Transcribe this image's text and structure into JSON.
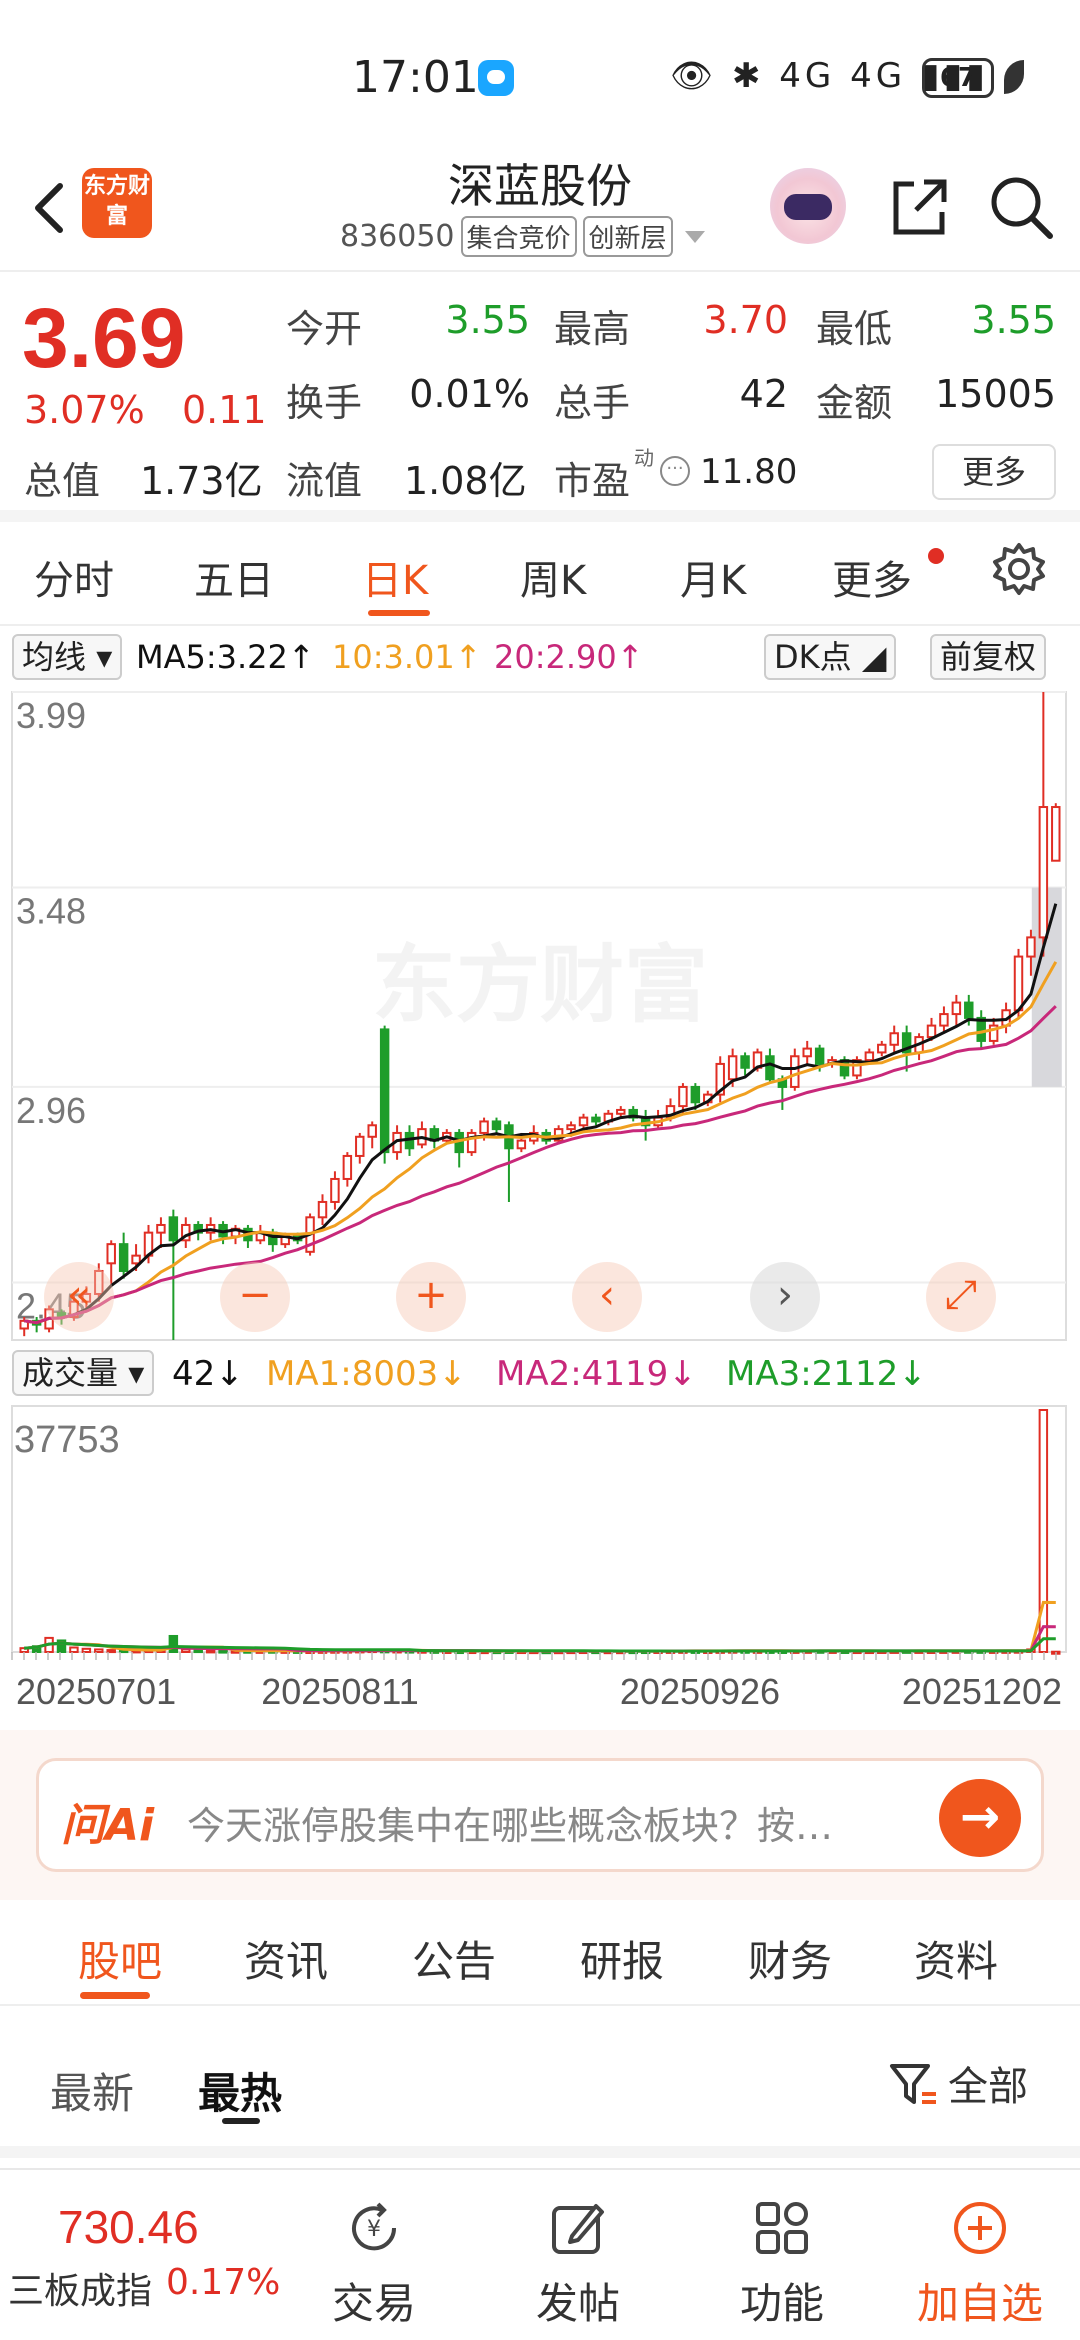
{
  "status_bar": {
    "time": "17:01",
    "battery": "67",
    "signal_text": "4G 4G"
  },
  "header": {
    "title": "深蓝股份",
    "code": "836050",
    "tags": [
      "集合竞价",
      "创新层"
    ],
    "logo_text": "东方财富"
  },
  "quote": {
    "price": "3.69",
    "change_pct": "3.07%",
    "change_amt": "0.11",
    "rows": [
      [
        {
          "l": "今开",
          "v": "3.55",
          "c": "green"
        },
        {
          "l": "最高",
          "v": "3.70",
          "c": "red"
        },
        {
          "l": "最低",
          "v": "3.55",
          "c": "green"
        }
      ],
      [
        {
          "l": "换手",
          "v": "0.01%",
          "c": ""
        },
        {
          "l": "总手",
          "v": "42",
          "c": ""
        },
        {
          "l": "金额",
          "v": "15005",
          "c": ""
        }
      ]
    ],
    "total_value_label": "总值",
    "total_value": "1.73亿",
    "float_value_label": "流值",
    "float_value": "1.08亿",
    "pe_label": "市盈",
    "pe_sup": "动",
    "pe_value": "11.80",
    "more": "更多"
  },
  "kline_tabs": [
    "分时",
    "五日",
    "日K",
    "周K",
    "月K",
    "更多"
  ],
  "kline_active": "日K",
  "ma_row": {
    "type_btn": "均线",
    "ma5": "MA5:3.22↑",
    "ma10": "10:3.01↑",
    "ma20": "20:2.90↑",
    "dk_btn": "DK点",
    "adjust_btn": "前复权"
  },
  "vol_row": {
    "type_btn": "成交量",
    "vol": "42↓",
    "ma1": "MA1:8003↓",
    "ma2": "MA2:4119↓",
    "ma3": "MA3:2112↓",
    "max_label": "37753"
  },
  "colors": {
    "up": "#e02e24",
    "down": "#1e9d2a",
    "ma5": "#111111",
    "ma10": "#f0a020",
    "ma20": "#c8287a",
    "accent": "#f0561d"
  },
  "watermark": "东方财富",
  "chart_data": {
    "type": "candlestick",
    "ylim": [
      2.3,
      3.99
    ],
    "y_ticks": [
      "3.99",
      "3.48",
      "2.96",
      "2.45"
    ],
    "x_ticks": [
      "20250701",
      "20250811",
      "20250926",
      "20251202"
    ],
    "candles": [
      [
        2.33,
        2.35,
        2.31,
        2.36
      ],
      [
        2.35,
        2.34,
        2.32,
        2.36
      ],
      [
        2.33,
        2.38,
        2.32,
        2.39
      ],
      [
        2.37,
        2.36,
        2.34,
        2.38
      ],
      [
        2.36,
        2.4,
        2.35,
        2.42
      ],
      [
        2.4,
        2.42,
        2.38,
        2.44
      ],
      [
        2.42,
        2.48,
        2.4,
        2.5
      ],
      [
        2.5,
        2.55,
        2.44,
        2.56
      ],
      [
        2.55,
        2.48,
        2.46,
        2.58
      ],
      [
        2.5,
        2.52,
        2.48,
        2.55
      ],
      [
        2.52,
        2.58,
        2.5,
        2.6
      ],
      [
        2.58,
        2.6,
        2.54,
        2.62
      ],
      [
        2.62,
        2.56,
        2.3,
        2.64
      ],
      [
        2.56,
        2.6,
        2.54,
        2.62
      ],
      [
        2.6,
        2.58,
        2.56,
        2.61
      ],
      [
        2.58,
        2.6,
        2.56,
        2.62
      ],
      [
        2.6,
        2.57,
        2.55,
        2.61
      ],
      [
        2.57,
        2.59,
        2.55,
        2.6
      ],
      [
        2.59,
        2.56,
        2.54,
        2.6
      ],
      [
        2.56,
        2.58,
        2.55,
        2.6
      ],
      [
        2.58,
        2.55,
        2.53,
        2.59
      ],
      [
        2.55,
        2.57,
        2.54,
        2.58
      ],
      [
        2.57,
        2.56,
        2.55,
        2.58
      ],
      [
        2.53,
        2.62,
        2.52,
        2.63
      ],
      [
        2.62,
        2.66,
        2.6,
        2.68
      ],
      [
        2.66,
        2.72,
        2.64,
        2.74
      ],
      [
        2.72,
        2.78,
        2.7,
        2.79
      ],
      [
        2.78,
        2.83,
        2.76,
        2.84
      ],
      [
        2.83,
        2.86,
        2.8,
        2.87
      ],
      [
        3.11,
        2.79,
        2.76,
        3.12
      ],
      [
        2.79,
        2.84,
        2.77,
        2.86
      ],
      [
        2.84,
        2.8,
        2.78,
        2.86
      ],
      [
        2.81,
        2.85,
        2.8,
        2.87
      ],
      [
        2.85,
        2.82,
        2.8,
        2.86
      ],
      [
        2.82,
        2.84,
        2.81,
        2.85
      ],
      [
        2.84,
        2.79,
        2.75,
        2.85
      ],
      [
        2.79,
        2.84,
        2.78,
        2.85
      ],
      [
        2.84,
        2.87,
        2.82,
        2.88
      ],
      [
        2.87,
        2.85,
        2.84,
        2.88
      ],
      [
        2.86,
        2.8,
        2.66,
        2.87
      ],
      [
        2.8,
        2.82,
        2.79,
        2.84
      ],
      [
        2.82,
        2.84,
        2.81,
        2.86
      ],
      [
        2.84,
        2.82,
        2.81,
        2.85
      ],
      [
        2.82,
        2.85,
        2.81,
        2.86
      ],
      [
        2.85,
        2.86,
        2.83,
        2.87
      ],
      [
        2.86,
        2.88,
        2.85,
        2.89
      ],
      [
        2.88,
        2.87,
        2.86,
        2.89
      ],
      [
        2.87,
        2.89,
        2.86,
        2.9
      ],
      [
        2.89,
        2.9,
        2.88,
        2.91
      ],
      [
        2.9,
        2.88,
        2.87,
        2.91
      ],
      [
        2.88,
        2.86,
        2.82,
        2.9
      ],
      [
        2.86,
        2.88,
        2.85,
        2.9
      ],
      [
        2.88,
        2.91,
        2.87,
        2.93
      ],
      [
        2.91,
        2.96,
        2.89,
        2.97
      ],
      [
        2.96,
        2.92,
        2.9,
        2.97
      ],
      [
        2.92,
        2.94,
        2.91,
        2.95
      ],
      [
        2.94,
        3.02,
        2.92,
        3.04
      ],
      [
        2.98,
        3.04,
        2.96,
        3.06
      ],
      [
        3.04,
        3.01,
        2.99,
        3.05
      ],
      [
        3.01,
        3.05,
        3.0,
        3.06
      ],
      [
        3.04,
        2.98,
        2.97,
        3.06
      ],
      [
        2.98,
        2.96,
        2.9,
        2.99
      ],
      [
        2.96,
        3.04,
        2.95,
        3.06
      ],
      [
        3.04,
        3.06,
        3.02,
        3.08
      ],
      [
        3.06,
        3.02,
        3.0,
        3.07
      ],
      [
        3.02,
        3.03,
        3.01,
        3.04
      ],
      [
        3.03,
        2.99,
        2.98,
        3.04
      ],
      [
        2.99,
        3.03,
        2.98,
        3.04
      ],
      [
        3.03,
        3.05,
        3.02,
        3.06
      ],
      [
        3.05,
        3.07,
        3.04,
        3.08
      ],
      [
        3.07,
        3.1,
        3.05,
        3.12
      ],
      [
        3.1,
        3.05,
        3.0,
        3.12
      ],
      [
        3.05,
        3.09,
        3.03,
        3.1
      ],
      [
        3.09,
        3.12,
        3.08,
        3.14
      ],
      [
        3.12,
        3.15,
        3.1,
        3.17
      ],
      [
        3.15,
        3.18,
        3.12,
        3.2
      ],
      [
        3.18,
        3.14,
        3.12,
        3.2
      ],
      [
        3.14,
        3.08,
        3.06,
        3.16
      ],
      [
        3.08,
        3.12,
        3.07,
        3.14
      ],
      [
        3.12,
        3.16,
        3.1,
        3.18
      ],
      [
        3.16,
        3.3,
        3.14,
        3.32
      ],
      [
        3.3,
        3.35,
        3.25,
        3.37
      ],
      [
        3.35,
        3.69,
        3.3,
        3.99
      ],
      [
        3.55,
        3.69,
        3.55,
        3.7
      ]
    ],
    "volume": [
      600,
      900,
      2200,
      1800,
      700,
      500,
      400,
      300,
      300,
      250,
      300,
      350,
      2500,
      400,
      300,
      250,
      220,
      200,
      200,
      180,
      200,
      180,
      170,
      160,
      180,
      200,
      220,
      250,
      300,
      260,
      240,
      220,
      200,
      180,
      160,
      150,
      150,
      140,
      140,
      160,
      150,
      140,
      130,
      130,
      140,
      150,
      140,
      130,
      130,
      140,
      150,
      160,
      170,
      180,
      170,
      160,
      180,
      200,
      190,
      180,
      170,
      160,
      170,
      180,
      190,
      170,
      160,
      150,
      150,
      160,
      170,
      180,
      170,
      160,
      170,
      180,
      190,
      180,
      170,
      180,
      200,
      400,
      37753,
      42
    ],
    "ma_vol": {
      "ma1": 8003,
      "ma2": 4119,
      "ma3": 2112
    }
  },
  "ai_bar": {
    "logo": "问Ai",
    "placeholder": "今天涨停股集中在哪些概念板块？按…"
  },
  "bottom_tabs": [
    "股吧",
    "资讯",
    "公告",
    "研报",
    "财务",
    "资料"
  ],
  "bottom_active": "股吧",
  "sub_tabs": [
    "最新",
    "最热"
  ],
  "sub_active": "最热",
  "filter_label": "全部",
  "footer": {
    "index_value": "730.46",
    "index_name": "三板成指",
    "index_pct": "0.17%",
    "buttons": [
      "交易",
      "发帖",
      "功能",
      "加自选"
    ]
  }
}
